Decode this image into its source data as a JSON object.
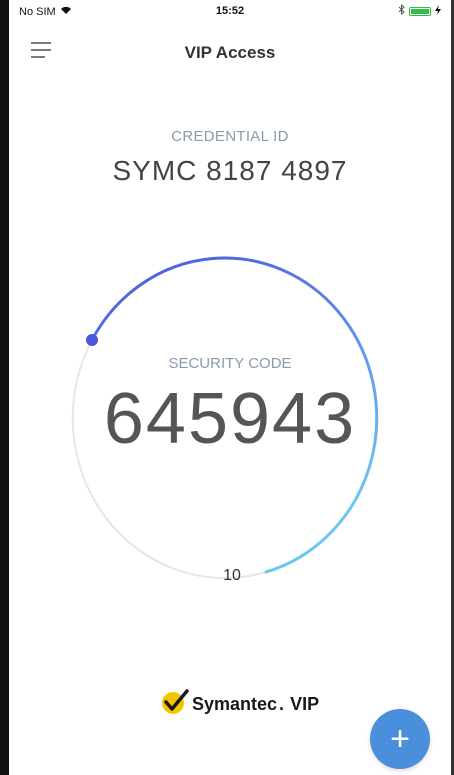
{
  "status_bar": {
    "carrier": "No SIM",
    "time": "15:52",
    "battery_color": "#2fbf4a"
  },
  "nav": {
    "title": "VIP Access",
    "menu_icon": "hamburger-icon"
  },
  "credential": {
    "label": "CREDENTIAL ID",
    "value": "SYMC 8187 4897"
  },
  "security": {
    "label": "SECURITY CODE",
    "code": "645943"
  },
  "timer": {
    "seconds_remaining": "10"
  },
  "brand": {
    "name": "Symantec",
    "suffix": "VIP",
    "check_color": "#f5c400"
  },
  "add_button": {
    "label": "+",
    "color": "#4a8fdc"
  },
  "ring_colors": {
    "start": "#4a56e0",
    "end": "#6ec6f0",
    "track": "#e6e6e6"
  }
}
